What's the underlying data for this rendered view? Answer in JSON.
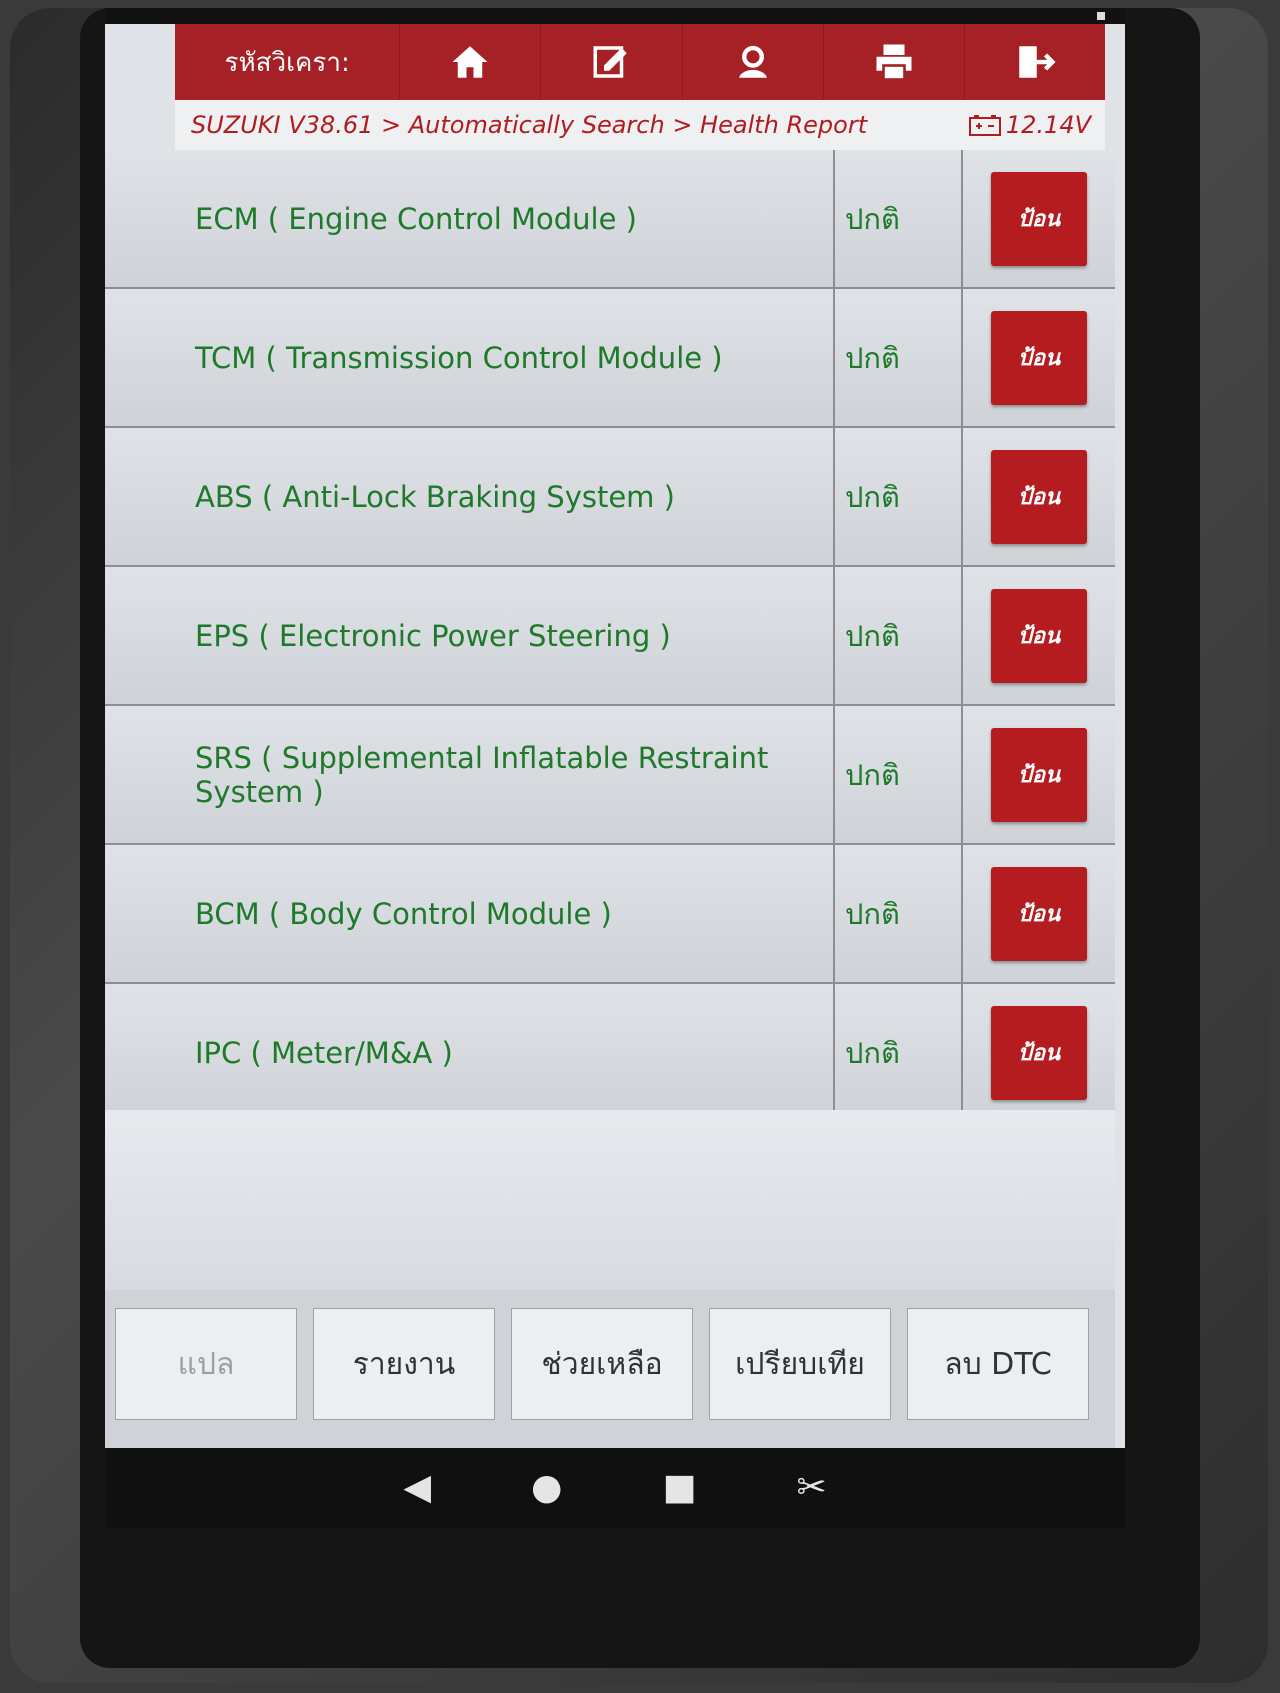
{
  "toolbar": {
    "title": "รหัสวิเครา:",
    "icons": [
      "home-icon",
      "edit-icon",
      "user-icon",
      "print-icon",
      "exit-icon"
    ]
  },
  "breadcrumb": {
    "text": "SUZUKI V38.61 > Automatically Search > Health Report"
  },
  "battery": {
    "voltage": "12.14V"
  },
  "modules": [
    {
      "name": "ECM ( Engine Control Module )",
      "status": "ปกติ",
      "action": "ป้อน"
    },
    {
      "name": "TCM ( Transmission Control Module )",
      "status": "ปกติ",
      "action": "ป้อน"
    },
    {
      "name": "ABS ( Anti-Lock Braking System )",
      "status": "ปกติ",
      "action": "ป้อน"
    },
    {
      "name": "EPS ( Electronic Power Steering )",
      "status": "ปกติ",
      "action": "ป้อน"
    },
    {
      "name": "SRS ( Supplemental Inflatable Restraint System )",
      "status": "ปกติ",
      "action": "ป้อน"
    },
    {
      "name": "BCM ( Body Control Module )",
      "status": "ปกติ",
      "action": "ป้อน"
    },
    {
      "name": "IPC ( Meter/M&A )",
      "status": "ปกติ",
      "action": "ป้อน"
    }
  ],
  "bottom_buttons": {
    "translate": "แปล",
    "report": "รายงาน",
    "help": "ช่วยเหลือ",
    "compare": "เปรียบเทีย",
    "clear_dtc": "ลบ DTC"
  },
  "colors": {
    "brand_red": "#a52125",
    "status_green": "#1e7a2a"
  }
}
